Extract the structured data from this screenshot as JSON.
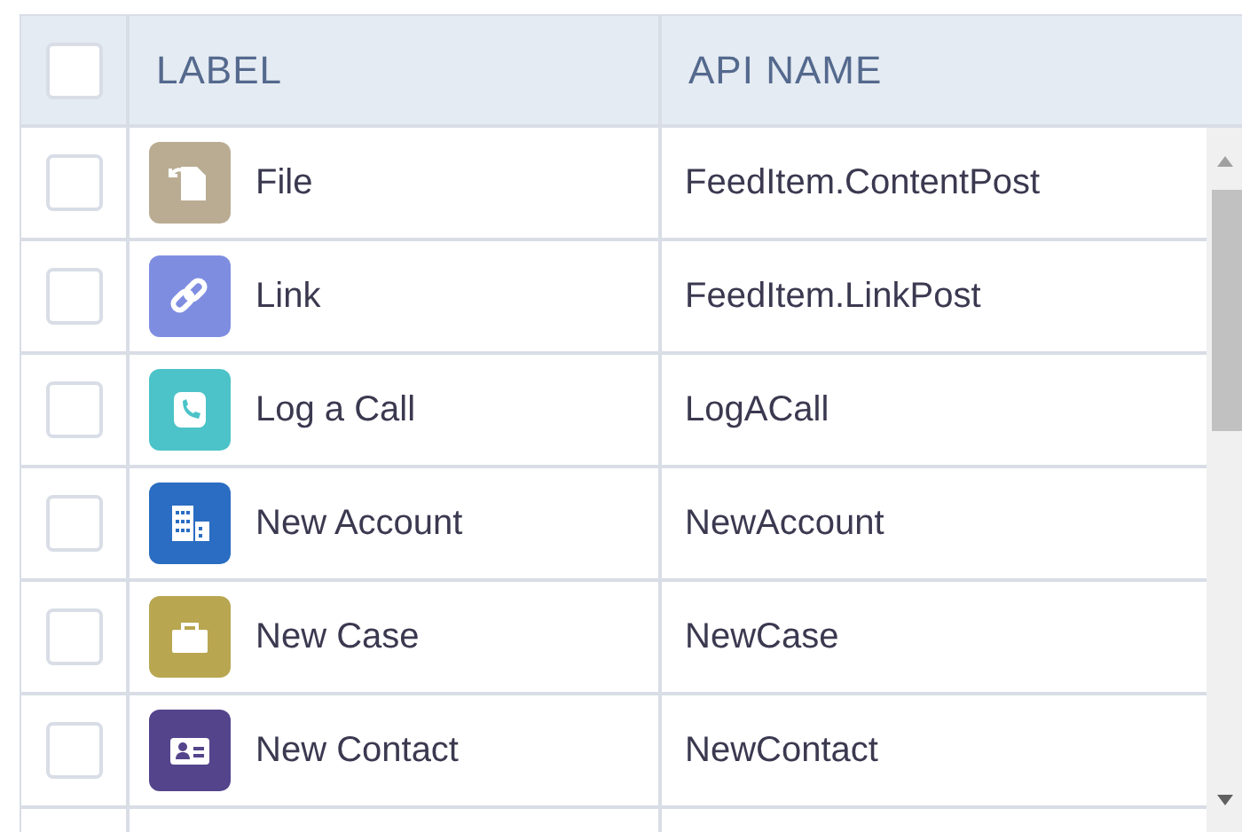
{
  "header": {
    "checked": false,
    "columns": [
      "LABEL",
      "API NAME"
    ]
  },
  "rows": [
    {
      "checked": false,
      "kind": "file",
      "color": "#baac93",
      "label": "File",
      "api_name": "FeedItem.ContentPost"
    },
    {
      "checked": false,
      "kind": "link",
      "color": "#7f8de1",
      "label": "Link",
      "api_name": "FeedItem.LinkPost"
    },
    {
      "checked": false,
      "kind": "call",
      "color": "#4bc3c8",
      "label": "Log a Call",
      "api_name": "LogACall"
    },
    {
      "checked": false,
      "kind": "account",
      "color": "#2a6dc2",
      "label": "New Account",
      "api_name": "NewAccount"
    },
    {
      "checked": false,
      "kind": "case",
      "color": "#b8a651",
      "label": "New Case",
      "api_name": "NewCase"
    },
    {
      "checked": false,
      "kind": "contact",
      "color": "#54448c",
      "label": "New Contact",
      "api_name": "NewContact"
    }
  ]
}
